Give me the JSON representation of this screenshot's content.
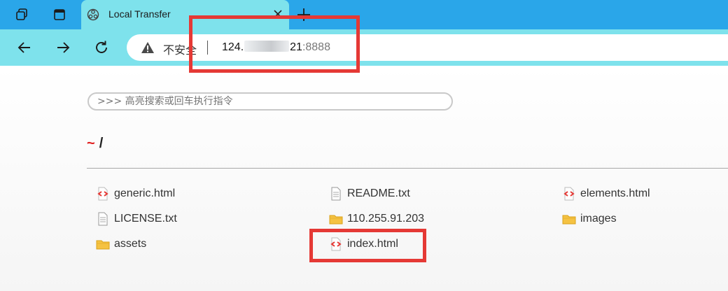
{
  "tab": {
    "title": "Local Transfer"
  },
  "omnibox": {
    "security_label": "不安全",
    "url_prefix": "124.",
    "url_suffix": "21",
    "url_port": ":8888"
  },
  "command_input": {
    "placeholder": ">>> 高亮搜索或回车执行指令"
  },
  "breadcrumb": {
    "home": "~",
    "separator": "/"
  },
  "files": [
    {
      "name": "generic.html",
      "type": "html"
    },
    {
      "name": "README.txt",
      "type": "text"
    },
    {
      "name": "elements.html",
      "type": "html"
    },
    {
      "name": "LICENSE.txt",
      "type": "text"
    },
    {
      "name": "110.255.91.203",
      "type": "folder"
    },
    {
      "name": "images",
      "type": "folder"
    },
    {
      "name": "assets",
      "type": "folder"
    },
    {
      "name": "index.html",
      "type": "html"
    }
  ],
  "colors": {
    "tabbar": "#2aa6e9",
    "toolbar": "#7ee2ec",
    "highlight": "#e53935",
    "tilde": "#e02020"
  }
}
